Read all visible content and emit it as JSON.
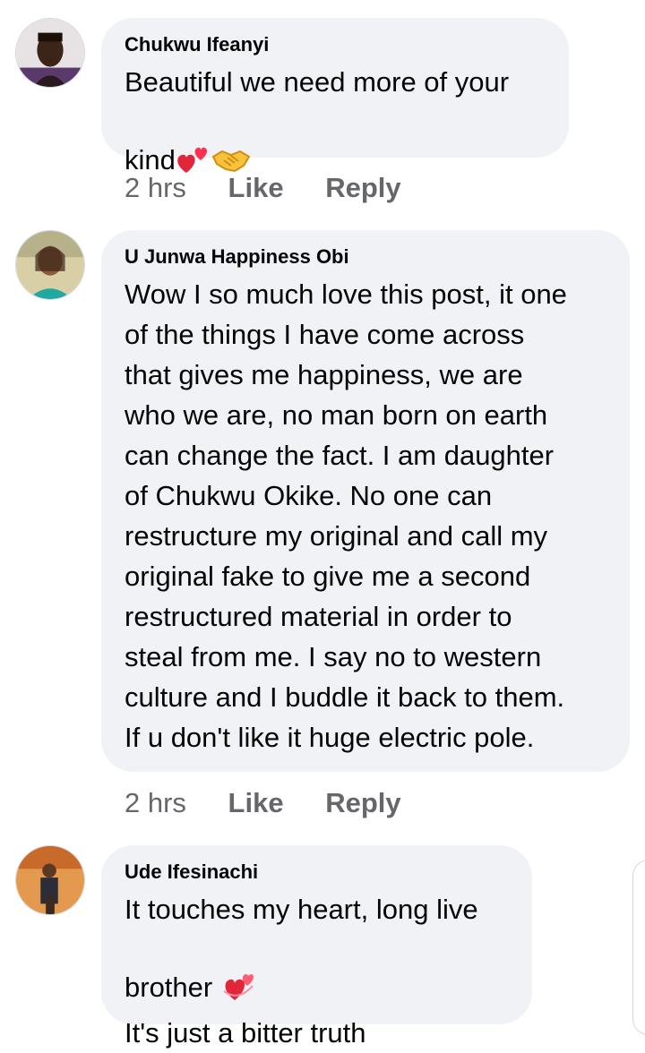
{
  "comments": [
    {
      "author": "Chukwu Ifeanyi",
      "text": "Beautiful we need more of your\nkind",
      "emoji_after": [
        "two-hearts-icon",
        "handshake-icon"
      ],
      "time": "2 hrs",
      "like_label": "Like",
      "reply_label": "Reply"
    },
    {
      "author": "U Junwa Happiness Obi",
      "text": "Wow I so much love this post, it one\nof the things I have come across\nthat gives me happiness, we are\nwho we are, no man born on earth\ncan change the fact. I am daughter\nof  Chukwu Okike. No one can\nrestructure my original and call my\noriginal fake to give me a second\nrestructured material in order to\nsteal from me. I say no to western\nculture and I buddle it back to them.\nIf u don't like it huge electric pole.",
      "time": "2 hrs",
      "like_label": "Like",
      "reply_label": "Reply"
    },
    {
      "author": "Ude Ifesinachi",
      "text_line1": "It touches my heart, long live",
      "text_line2": "brother",
      "text_line3": "It's just a bitter truth",
      "emoji_after": [
        "revolving-hearts-icon"
      ]
    }
  ],
  "colors": {
    "bubble": "#f0f2f5",
    "meta_text": "#65676b",
    "text": "#050505"
  }
}
